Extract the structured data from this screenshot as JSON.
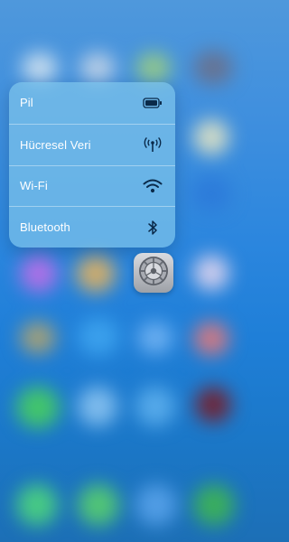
{
  "quick_actions": {
    "items": [
      {
        "label": "Pil",
        "icon": "battery-icon"
      },
      {
        "label": "Hücresel Veri",
        "icon": "cellular-antenna-icon"
      },
      {
        "label": "Wi-Fi",
        "icon": "wifi-icon"
      },
      {
        "label": "Bluetooth",
        "icon": "bluetooth-icon"
      }
    ]
  },
  "app": {
    "icon": "settings-gear-icon"
  },
  "colors": {
    "menu_background": "#7dc4ea",
    "text": "#ffffff",
    "wallpaper_top": "#4f98dc",
    "wallpaper_bottom": "#1c6fb6"
  }
}
